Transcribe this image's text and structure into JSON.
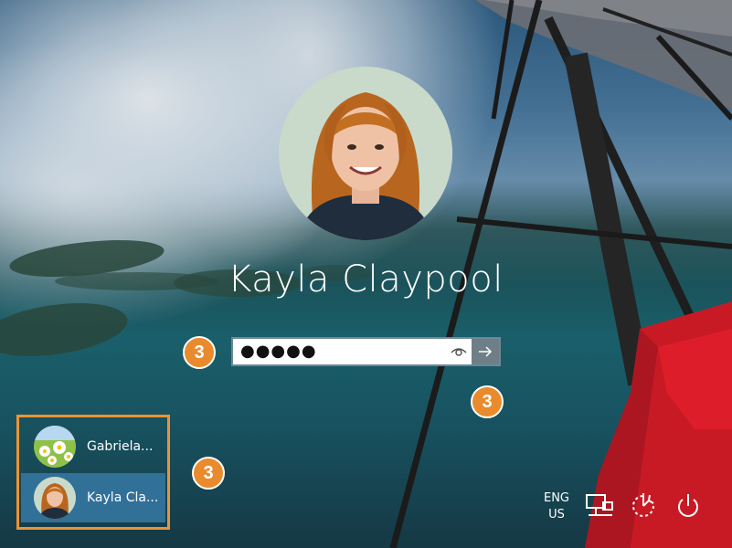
{
  "login": {
    "user_name": "Kayla Claypool",
    "password_masked": "●●●●●"
  },
  "callouts": {
    "password": "3",
    "submit": "3",
    "user_list": "3"
  },
  "user_switcher": {
    "items": [
      {
        "label": "Gabriela..."
      },
      {
        "label": "Kayla Cla..."
      }
    ]
  },
  "system_tray": {
    "language_line1": "ENG",
    "language_line2": "US",
    "icons": [
      "network-icon",
      "ease-of-access-icon",
      "power-icon"
    ]
  },
  "colors": {
    "callout": "#e98b2d",
    "selected_user": "#3476a0",
    "submit_button": "#6f7f88"
  }
}
